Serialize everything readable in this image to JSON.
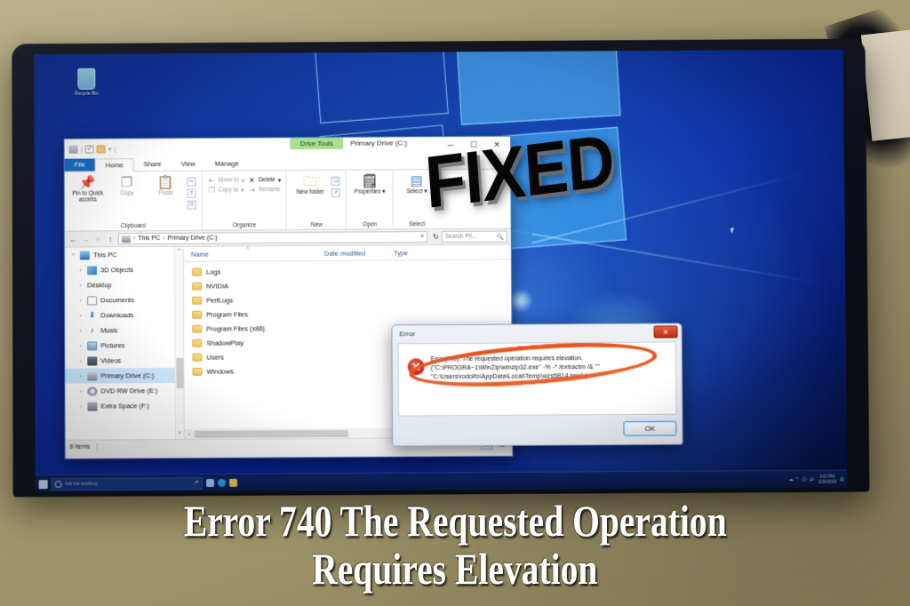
{
  "overlay": {
    "fixed_badge": "FIXED",
    "caption_line_1": "Error 740 The Requested Operation",
    "caption_line_2": "Requires Elevation"
  },
  "desktop": {
    "recycle_bin_label": "Recycle Bin"
  },
  "taskbar": {
    "search_placeholder": "Ask me anything",
    "clock_time": "3:07 PM",
    "clock_date": "1/24/2019"
  },
  "explorer": {
    "window_title": "Primary Drive (C:)",
    "contextual_tab": "Drive Tools",
    "quick_access_icons": [
      "drive-icon",
      "properties-icon",
      "new-folder-icon",
      "customize-caret"
    ],
    "window_buttons": {
      "minimize": "─",
      "maximize": "☐",
      "close": "✕"
    },
    "tabs": [
      {
        "label": "File",
        "state": "file"
      },
      {
        "label": "Home",
        "state": "active"
      },
      {
        "label": "Share",
        "state": "normal"
      },
      {
        "label": "View",
        "state": "normal"
      },
      {
        "label": "Manage",
        "state": "contextual"
      }
    ],
    "ribbon": {
      "groups": [
        {
          "label": "Clipboard",
          "buttons": [
            {
              "label": "Pin to Quick access",
              "icon": "pin-icon",
              "enabled": true
            },
            {
              "label": "Copy",
              "icon": "copy-icon",
              "enabled": false
            },
            {
              "label": "Paste",
              "icon": "paste-icon",
              "enabled": false
            }
          ],
          "mini_buttons": [
            "cut-icon",
            "copy-path-icon",
            "paste-shortcut-icon"
          ]
        },
        {
          "label": "Organize",
          "small_buttons": [
            {
              "label": "Move to",
              "enabled": false,
              "caret": true
            },
            {
              "label": "Copy to",
              "enabled": false,
              "caret": true
            },
            {
              "label": "Delete",
              "enabled": true,
              "caret": true
            },
            {
              "label": "Rename",
              "enabled": false,
              "caret": false
            }
          ]
        },
        {
          "label": "New",
          "buttons": [
            {
              "label": "New folder",
              "icon": "new-folder-icon",
              "enabled": true
            }
          ],
          "mini_buttons": [
            "new-item-icon",
            "easy-access-icon"
          ]
        },
        {
          "label": "Open",
          "buttons": [
            {
              "label": "Properties",
              "icon": "properties-icon",
              "enabled": true
            }
          ]
        },
        {
          "label": "Select",
          "buttons": [
            {
              "label": "Select",
              "icon": "select-icon",
              "enabled": true
            }
          ]
        }
      ]
    },
    "address_bar": {
      "back_icon": "back-arrow-icon",
      "forward_icon": "forward-arrow-icon",
      "recent_icon": "recent-locations-icon",
      "up_icon": "up-arrow-icon",
      "breadcrumb": [
        "This PC",
        "Primary Drive (C:)"
      ],
      "refresh_icon": "refresh-icon",
      "search_placeholder": "Search Pri..."
    },
    "nav_pane": [
      {
        "label": "This PC",
        "level": 0,
        "icon": "pc-icon",
        "expanded": true,
        "selected": false
      },
      {
        "label": "3D Objects",
        "level": 1,
        "icon": "3d-objects-icon",
        "expanded": false,
        "selected": false
      },
      {
        "label": "Desktop",
        "level": 1,
        "icon": "desktop-icon",
        "expanded": false,
        "selected": false
      },
      {
        "label": "Documents",
        "level": 1,
        "icon": "documents-icon",
        "expanded": false,
        "selected": false
      },
      {
        "label": "Downloads",
        "level": 1,
        "icon": "downloads-icon",
        "expanded": false,
        "selected": false
      },
      {
        "label": "Music",
        "level": 1,
        "icon": "music-icon",
        "expanded": false,
        "selected": false
      },
      {
        "label": "Pictures",
        "level": 1,
        "icon": "pictures-icon",
        "expanded": false,
        "selected": false
      },
      {
        "label": "Videos",
        "level": 1,
        "icon": "videos-icon",
        "expanded": false,
        "selected": false
      },
      {
        "label": "Primary Drive (C:)",
        "level": 1,
        "icon": "drive-icon",
        "expanded": false,
        "selected": true
      },
      {
        "label": "DVD RW Drive (E:)",
        "level": 1,
        "icon": "dvd-drive-icon",
        "expanded": false,
        "selected": false
      },
      {
        "label": "Extra Space (F:)",
        "level": 1,
        "icon": "hdd-icon",
        "expanded": false,
        "selected": false
      }
    ],
    "columns": [
      "Name",
      "Date modified",
      "Type"
    ],
    "files": [
      {
        "name": "Logs",
        "icon": "folder-icon"
      },
      {
        "name": "NVIDIA",
        "icon": "folder-icon"
      },
      {
        "name": "PerfLogs",
        "icon": "folder-icon"
      },
      {
        "name": "Program Files",
        "icon": "folder-icon"
      },
      {
        "name": "Program Files (x86)",
        "icon": "folder-icon"
      },
      {
        "name": "ShadowPlay",
        "icon": "folder-icon"
      },
      {
        "name": "Users",
        "icon": "folder-icon"
      },
      {
        "name": "Windows",
        "icon": "folder-icon"
      }
    ],
    "status_bar": {
      "item_count": "8 items",
      "view_detail_icon": "details-view-icon",
      "view_large_icon": "large-icons-view-icon"
    }
  },
  "error_dialog": {
    "title": "Error",
    "close_label": "✕",
    "icon": "error-x-icon",
    "message_line_1": "Error(740): The requested operation requires elevation.",
    "message_line_2": "(\"C:\\PROGRA~1\\WinZip\\winzip32.exe\"  -%  -* /extractm /& \"\"",
    "message_line_3": "\"C:\\Users\\rodolfo\\AppData\\Local\\Temp\\wzs5B14.tmp\" )",
    "ok_label": "OK",
    "annotation_color": "#e8561e"
  },
  "colors": {
    "accent_blue": "#1669c1",
    "contextual_green": "#a8e08f",
    "selection_blue": "#cce8ff",
    "error_red": "#b51b1b",
    "annotation_orange": "#e8561e",
    "wallpaper_blue": "#0a2a92"
  }
}
